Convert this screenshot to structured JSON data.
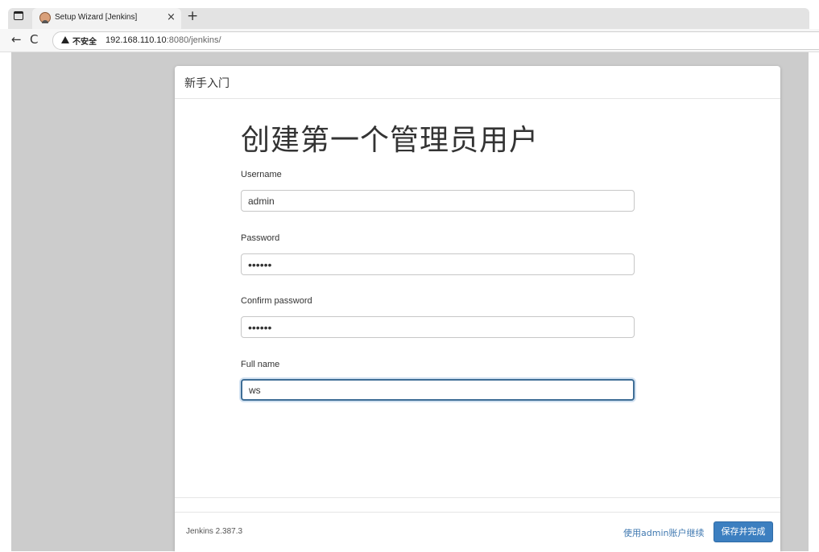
{
  "browser": {
    "tab_title": "Setup Wizard [Jenkins]",
    "tab_close": "×",
    "new_tab": "+",
    "back": "←",
    "reload": "C",
    "security_label": "不安全",
    "url_host": "192.168.110.10",
    "url_path": ":8080/jenkins/"
  },
  "dialog": {
    "title": "新手入门",
    "heading": "创建第一个管理员用户",
    "fields": [
      {
        "label": "Username",
        "value": "admin"
      },
      {
        "label": "Password",
        "value": "••••••"
      },
      {
        "label": "Confirm password",
        "value": "••••••"
      },
      {
        "label": "Full name",
        "value": "ws"
      }
    ]
  },
  "footer": {
    "version": "Jenkins 2.387.3",
    "continue_label": "使用admin账户继续",
    "save_label": "保存并完成"
  },
  "colors": {
    "accent": "#3c7fc0",
    "link": "#3f78b0",
    "backdrop": "#cccccc"
  }
}
